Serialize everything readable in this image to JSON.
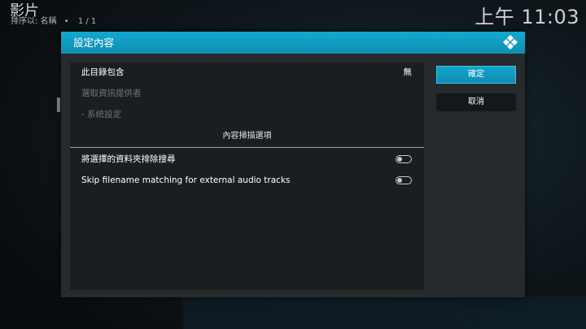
{
  "header": {
    "title": "影片",
    "sort_label": "排序以: 名稱",
    "separator": "•",
    "page_count": "1 / 1"
  },
  "clock": "上午 11:03",
  "dialog": {
    "title": "設定內容",
    "logo_icon": "kodi-logo-icon",
    "rows": [
      {
        "label": "此目錄包含",
        "value": "無",
        "state": "active"
      },
      {
        "label": "選取資訊提供者",
        "state": "disabled"
      },
      {
        "label": "- 系統設定",
        "state": "disabled"
      }
    ],
    "section_header": "內容掃描選項",
    "toggles": [
      {
        "label": "將選擇的資料夾排除搜尋",
        "enabled": false
      },
      {
        "label": "Skip filename matching for external audio tracks",
        "enabled": false
      }
    ],
    "buttons": {
      "ok": "確定",
      "cancel": "取消"
    }
  },
  "colors": {
    "accent": "#12a0c6",
    "dialog_bg": "#262a2d",
    "list_bg": "#1b1e21",
    "disabled_text": "#6f7478"
  }
}
